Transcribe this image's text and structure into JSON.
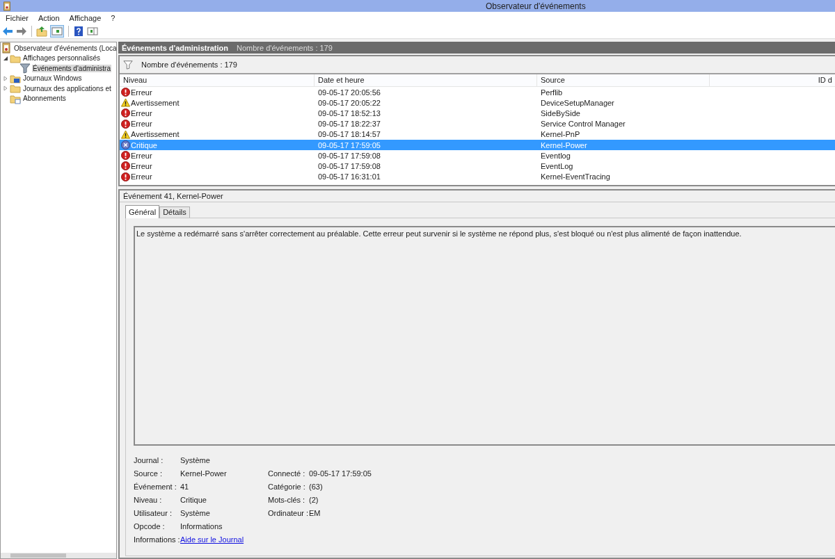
{
  "window": {
    "title": "Observateur d'événements"
  },
  "menu": [
    "Fichier",
    "Action",
    "Affichage",
    "?"
  ],
  "tree": [
    {
      "label": "Observateur d'événements (Loca",
      "kind": "root",
      "selected": false,
      "children": [
        {
          "label": "Affichages personnalisés",
          "kind": "folder",
          "selected": false,
          "expanded": true,
          "children": [
            {
              "label": "Événements d'administra",
              "kind": "filter",
              "selected": true
            }
          ]
        },
        {
          "label": "Journaux Windows",
          "kind": "logs",
          "selected": false,
          "expanded": false
        },
        {
          "label": "Journaux des applications et",
          "kind": "folder",
          "selected": false,
          "expanded": false
        },
        {
          "label": "Abonnements",
          "kind": "subs",
          "selected": false
        }
      ]
    }
  ],
  "header": {
    "title": "Événements d'administration",
    "count": "Nombre d'événements : 179"
  },
  "filter_bar": {
    "text": "Nombre d'événements : 179"
  },
  "table": {
    "columns": [
      "Niveau",
      "Date et heure",
      "Source",
      "ID d"
    ],
    "rows": [
      {
        "kind": "error",
        "level": "Erreur",
        "date": "09-05-17 20:05:56",
        "source": "Perflib",
        "selected": false
      },
      {
        "kind": "warning",
        "level": "Avertissement",
        "date": "09-05-17 20:05:22",
        "source": "DeviceSetupManager",
        "selected": false
      },
      {
        "kind": "error",
        "level": "Erreur",
        "date": "09-05-17 18:52:13",
        "source": "SideBySide",
        "selected": false
      },
      {
        "kind": "error",
        "level": "Erreur",
        "date": "09-05-17 18:22:37",
        "source": "Service Control Manager",
        "selected": false
      },
      {
        "kind": "warning",
        "level": "Avertissement",
        "date": "09-05-17 18:14:57",
        "source": "Kernel-PnP",
        "selected": false
      },
      {
        "kind": "critical",
        "level": "Critique",
        "date": "09-05-17 17:59:05",
        "source": "Kernel-Power",
        "selected": true
      },
      {
        "kind": "error",
        "level": "Erreur",
        "date": "09-05-17 17:59:08",
        "source": "Eventlog",
        "selected": false
      },
      {
        "kind": "error",
        "level": "Erreur",
        "date": "09-05-17 17:59:08",
        "source": "EventLog",
        "selected": false
      },
      {
        "kind": "error",
        "level": "Erreur",
        "date": "09-05-17 16:31:01",
        "source": "Kernel-EventTracing",
        "selected": false
      }
    ]
  },
  "details": {
    "title": "Événement 41, Kernel-Power",
    "tabs": [
      {
        "label": "Général",
        "selected": true
      },
      {
        "label": "Détails",
        "selected": false
      }
    ],
    "description": "Le système a redémarré sans s'arrêter correctement au préalable. Cette erreur peut survenir si le système ne répond plus, s'est bloqué ou n'est plus alimenté de façon inattendue.",
    "properties": [
      {
        "kind": "text",
        "label": "Journal :",
        "value": "Système"
      },
      {
        "kind": "text",
        "label": "Source :",
        "value": "Kernel-Power",
        "label_2": "Connecté :",
        "value_2": "09-05-17 17:59:05"
      },
      {
        "kind": "text",
        "label": "Événement :",
        "value": "41",
        "label_2": "Catégorie :",
        "value_2": "(63)"
      },
      {
        "kind": "text",
        "label": "Niveau :",
        "value": "Critique",
        "label_2": "Mots-clés :",
        "value_2": "(2)"
      },
      {
        "kind": "text",
        "label": "Utilisateur :",
        "value": "Système",
        "label_2": "Ordinateur :",
        "value_2": "EM"
      },
      {
        "kind": "text",
        "label": "Opcode :",
        "value": "Informations"
      },
      {
        "kind": "link",
        "label": "Informations :",
        "value": "Aide sur le Journal"
      }
    ]
  }
}
